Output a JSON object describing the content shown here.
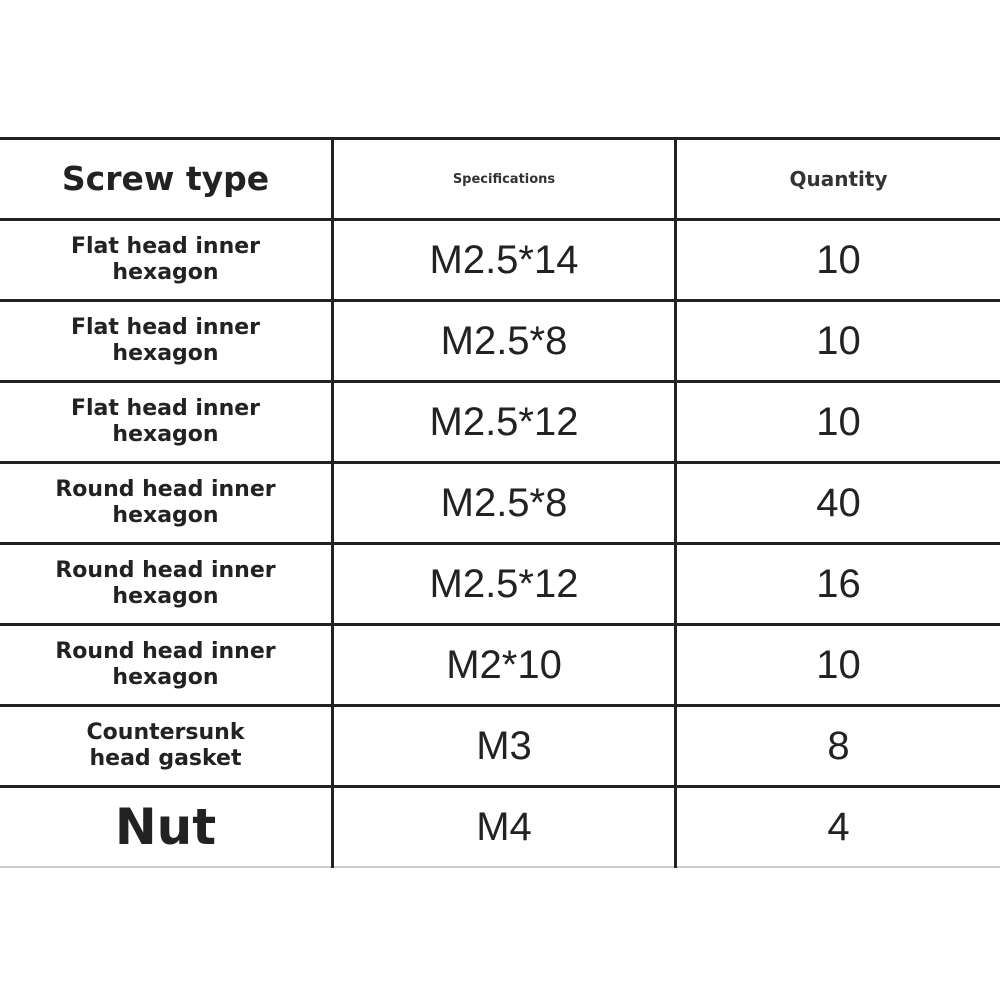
{
  "table": {
    "headers": [
      "Screw type",
      "Specifications",
      "Quantity"
    ],
    "rows": [
      {
        "type": "Flat head inner hexagon",
        "spec": "M2.5*14",
        "qty": "10"
      },
      {
        "type": "Flat head inner hexagon",
        "spec": "M2.5*8",
        "qty": "10"
      },
      {
        "type": "Flat head inner hexagon",
        "spec": "M2.5*12",
        "qty": "10"
      },
      {
        "type": "Round head inner hexagon",
        "spec": "M2.5*8",
        "qty": "40"
      },
      {
        "type": "Round head inner hexagon",
        "spec": "M2.5*12",
        "qty": "16"
      },
      {
        "type": "Round head inner hexagon",
        "spec": "M2*10",
        "qty": "10"
      },
      {
        "type": "Countersunk head gasket",
        "spec": "M3",
        "qty": "8"
      },
      {
        "type": "Nut",
        "spec": "M4",
        "qty": "4"
      }
    ]
  }
}
